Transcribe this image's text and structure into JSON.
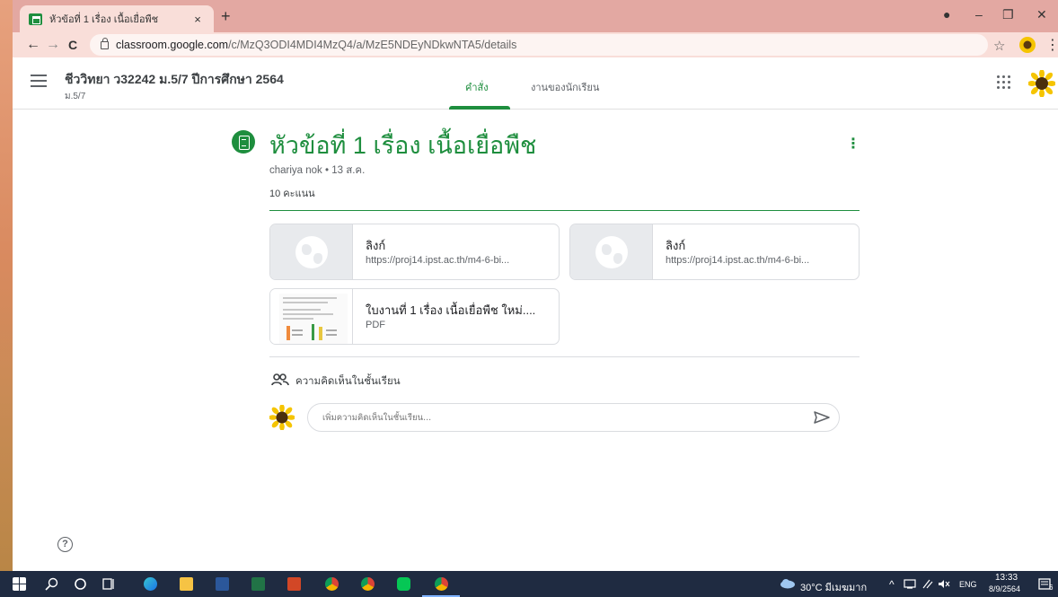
{
  "browser": {
    "tab_title": "หัวข้อที่ 1 เรื่อง เนื้อเยื่อพืช",
    "tab_close": "×",
    "new_tab": "+",
    "url_domain": "classroom.google.com",
    "url_path": "/c/MzQ3ODI4MDI4MzQ4/a/MzE5NDEyNDkwNTA5/details",
    "back": "←",
    "forward": "→",
    "reload": "C",
    "star": "☆",
    "menu": "⋮",
    "minimize": "–",
    "restore": "❐",
    "close": "✕"
  },
  "header": {
    "class_title": "ชีววิทยา ว32242 ม.5/7 ปีการศึกษา 2564",
    "class_section": "ม.5/7",
    "tabs": [
      {
        "label": "คำสั่ง",
        "active": true
      },
      {
        "label": "งานของนักเรียน",
        "active": false
      }
    ]
  },
  "assignment": {
    "title": "หัวข้อที่ 1 เรื่อง เนื้อเยื่อพืช",
    "author_date": "chariya nok • 13 ส.ค.",
    "points": "10 คะแนน",
    "menu": "⋮",
    "attachments": [
      {
        "title": "ลิงก์",
        "subtitle": "https://proj14.ipst.ac.th/m4-6-bi...",
        "type": "link-icon"
      },
      {
        "title": "ลิงก์",
        "subtitle": "https://proj14.ipst.ac.th/m4-6-bi...",
        "type": "link-icon"
      },
      {
        "title": "ใบงานที่ 1 เรื่อง เนื้อเยื่อพืช ใหม่....",
        "subtitle": "PDF",
        "type": "pdf-thumbnail"
      }
    ]
  },
  "comments": {
    "label": "ความคิดเห็นในชั้นเรียน",
    "placeholder": "เพิ่มความคิดเห็นในชั้นเรียน..."
  },
  "help": "?",
  "taskbar": {
    "weather": "30°C มีเมฆมาก",
    "tray": "^",
    "language": "ENG",
    "time": "13:33",
    "date": "8/9/2564",
    "notifications": "6"
  },
  "colors": {
    "accent": "#1e8e3e",
    "tab_strip": "#e3a8a2",
    "taskbar": "#1f2b41"
  }
}
